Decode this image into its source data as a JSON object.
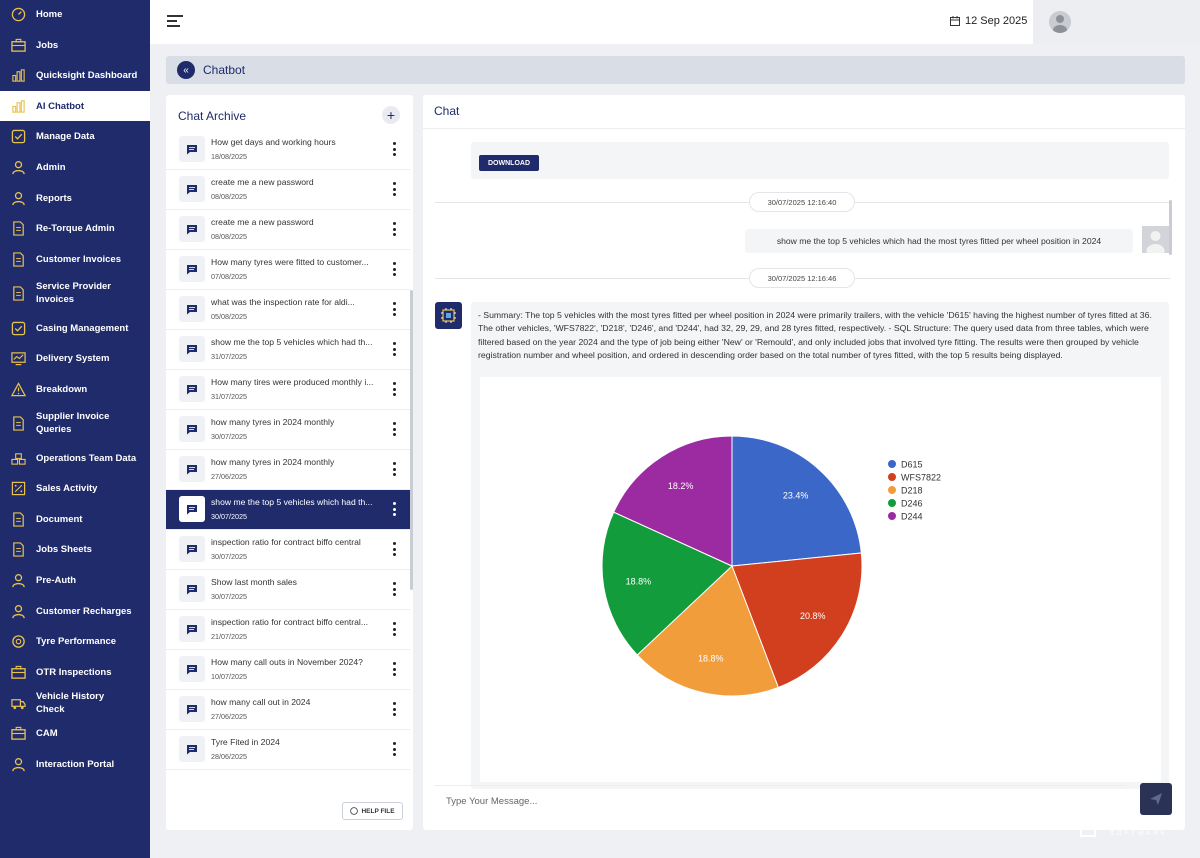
{
  "sidebar": {
    "items": [
      {
        "label": "Home",
        "icon": "gauge-icon"
      },
      {
        "label": "Jobs",
        "icon": "briefcase-icon"
      },
      {
        "label": "Quicksight Dashboard",
        "icon": "bar-chart-icon"
      },
      {
        "label": "AI Chatbot",
        "icon": "bar-chart-icon",
        "active": true
      },
      {
        "label": "Manage Data",
        "icon": "check-square-icon"
      },
      {
        "label": "Admin",
        "icon": "user-icon"
      },
      {
        "label": "Reports",
        "icon": "user-icon"
      },
      {
        "label": "Re-Torque Admin",
        "icon": "document-icon"
      },
      {
        "label": "Customer Invoices",
        "icon": "document-icon"
      },
      {
        "label": "Service Provider Invoices",
        "icon": "document-icon"
      },
      {
        "label": "Casing Management",
        "icon": "check-square-icon"
      },
      {
        "label": "Delivery System",
        "icon": "monitor-chart-icon"
      },
      {
        "label": "Breakdown",
        "icon": "warning-icon"
      },
      {
        "label": "Supplier Invoice Queries",
        "icon": "document-icon"
      },
      {
        "label": "Operations Team Data",
        "icon": "stack-icon"
      },
      {
        "label": "Sales Activity",
        "icon": "percent-icon"
      },
      {
        "label": "Document",
        "icon": "document-icon"
      },
      {
        "label": "Jobs Sheets",
        "icon": "document-icon"
      },
      {
        "label": "Pre-Auth",
        "icon": "user-icon"
      },
      {
        "label": "Customer Recharges",
        "icon": "user-icon"
      },
      {
        "label": "Tyre Performance",
        "icon": "tyre-icon"
      },
      {
        "label": "OTR Inspections",
        "icon": "briefcase-icon"
      },
      {
        "label": "Vehicle History Check",
        "icon": "truck-icon"
      },
      {
        "label": "CAM",
        "icon": "briefcase-icon"
      },
      {
        "label": "Interaction Portal",
        "icon": "user-icon"
      }
    ]
  },
  "topbar": {
    "date": "12 Sep 2025"
  },
  "breadcrumb": {
    "title": "Chatbot"
  },
  "archive": {
    "title": "Chat Archive",
    "add": "+",
    "help": "HELP FILE",
    "items": [
      {
        "title": "How get days and working hours",
        "date": "18/08/2025"
      },
      {
        "title": "create me a new password",
        "date": "08/08/2025"
      },
      {
        "title": "create me a new password",
        "date": "08/08/2025"
      },
      {
        "title": "How many tyres were fitted to customer...",
        "date": "07/08/2025"
      },
      {
        "title": "what was the inspection rate for aldi...",
        "date": "05/08/2025"
      },
      {
        "title": "show me the top 5 vehicles which had th...",
        "date": "31/07/2025"
      },
      {
        "title": "How many tires were produced monthly i...",
        "date": "31/07/2025"
      },
      {
        "title": "how many tyres in 2024 monthly",
        "date": "30/07/2025"
      },
      {
        "title": "how many tyres in 2024 monthly",
        "date": "27/06/2025"
      },
      {
        "title": "show me the top 5 vehicles which had th...",
        "date": "30/07/2025",
        "active": true
      },
      {
        "title": "inspection ratio for contract biffo central",
        "date": "30/07/2025"
      },
      {
        "title": "Show last month sales",
        "date": "30/07/2025"
      },
      {
        "title": "inspection ratio for contract biffo central...",
        "date": "21/07/2025"
      },
      {
        "title": "How many call outs in November 2024?",
        "date": "10/07/2025"
      },
      {
        "title": "how many call out in 2024",
        "date": "27/06/2025"
      },
      {
        "title": "Tyre Fited in 2024",
        "date": "28/06/2025"
      }
    ]
  },
  "chat": {
    "title": "Chat",
    "download": "DOWNLOAD",
    "timestamp1": "30/07/2025 12:16:40",
    "user_message": "show me the top 5 vehicles which had the most tyres fitted per wheel position in 2024",
    "timestamp2": "30/07/2025 12:16:46",
    "bot_message": "- Summary: The top 5 vehicles with the most tyres fitted per wheel position in 2024 were primarily trailers, with the vehicle 'D615' having the highest number of tyres fitted at 36. The other vehicles, 'WFS7822', 'D218', 'D246', and 'D244', had 32, 29, 29, and 28 tyres fitted, respectively. - SQL Structure: The query used data from three tables, which were filtered based on the year 2024 and the type of job being either 'New' or 'Remould', and only included jobs that involved tyre fitting. The results were then grouped by vehicle registration number and wheel position, and ordered in descending order based on the total number of tyres fitted, with the top 5 results being displayed.",
    "input_placeholder": "Type Your Message..."
  },
  "chart_data": {
    "type": "pie",
    "categories": [
      "D615",
      "WFS7822",
      "D218",
      "D246",
      "D244"
    ],
    "values": [
      23.4,
      20.8,
      18.8,
      18.8,
      18.2
    ],
    "labels": [
      "23.4%",
      "20.8%",
      "18.8%",
      "18.8%",
      "18.2%"
    ],
    "colors": [
      "#3b67c9",
      "#d23f1f",
      "#f29d3c",
      "#139c3b",
      "#9c2aa0"
    ],
    "legend": "top-right"
  },
  "logo": {
    "name": "spaculus",
    "sub": "SOFTWARE"
  }
}
